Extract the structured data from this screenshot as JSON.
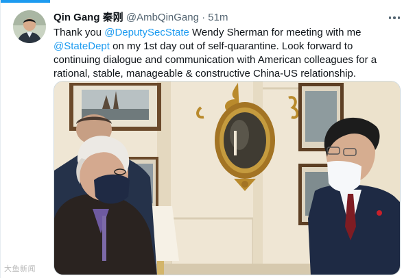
{
  "tweet": {
    "author_name": "Qin Gang 秦刚",
    "handle": "@AmbQinGang",
    "separator": "·",
    "time": "51m",
    "text": {
      "part1": "Thank you ",
      "mention1": "@DeputySecState",
      "part2": " Wendy Sherman for meeting with me ",
      "mention2": "@StateDept",
      "part3": " on my 1st day out of self-quarantine. Look forward to continuing dialogue and communication with American colleagues for a rational, stable, manageable & constructive China-US relationship."
    }
  },
  "watermark": "大鱼新闻",
  "colors": {
    "accent": "#1d9bf0",
    "text": "#0f1419",
    "secondary": "#536471"
  },
  "icons": {
    "more": "more-options-icon"
  }
}
